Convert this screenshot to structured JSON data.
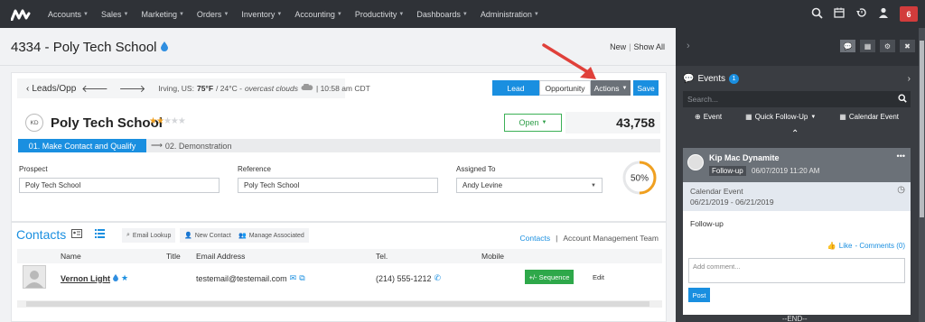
{
  "nav": {
    "menu": [
      "Accounts",
      "Sales",
      "Marketing",
      "Orders",
      "Inventory",
      "Accounting",
      "Productivity",
      "Dashboards",
      "Administration"
    ],
    "notification_count": "6"
  },
  "header": {
    "title": "4334 - Poly Tech School",
    "link_new": "New",
    "link_show_all": "Show All"
  },
  "toolbar": {
    "back_label": "Leads/Opp",
    "location": "Irving, US:",
    "temp_f": "75°F",
    "temp_c": "/ 24°C -",
    "conditions": "overcast clouds",
    "time": "| 10:58 am CDT",
    "lead_btn": "Lead",
    "opportunity_btn": "Opportunity",
    "actions_btn": "Actions",
    "save_btn": "Save"
  },
  "lead": {
    "initials": "KD",
    "name": "Poly Tech School",
    "rating": 2,
    "rating_max": 5,
    "status": "Open",
    "amount": "43,758"
  },
  "stages": {
    "current": "01. Make Contact and Qualify",
    "next": "02. Demonstration"
  },
  "fields": {
    "prospect_label": "Prospect",
    "prospect_value": "Poly Tech School",
    "reference_label": "Reference",
    "reference_value": "Poly Tech School",
    "assigned_label": "Assigned To",
    "assigned_value": "Andy Levine",
    "progress_text": "50%",
    "progress_fraction": 0.5
  },
  "contacts": {
    "title": "Contacts",
    "email_lookup": "Email Lookup",
    "new_contact": "New Contact",
    "manage_associated": "Manage Associated",
    "tab_contacts": "Contacts",
    "tab_sep": "|",
    "tab_account_team": "Account Management Team",
    "columns": [
      "Name",
      "Title",
      "Email Address",
      "Tel.",
      "Mobile"
    ],
    "rows": [
      {
        "name": "Vernon Light",
        "title": "",
        "email": "testemail@testemail.com",
        "tel": "(214) 555-1212",
        "mobile": "",
        "sequence_btn": "+/- Sequence",
        "edit": "Edit"
      }
    ]
  },
  "side": {
    "events_title": "Events",
    "events_count": "1",
    "search_placeholder": "Search...",
    "action_event": "Event",
    "action_quick_follow": "Quick Follow-Up",
    "action_calendar": "Calendar Event",
    "card": {
      "name": "Kip Mac Dynamite",
      "tag": "Follow-up",
      "date": "06/07/2019 11:20 AM",
      "type": "Calendar Event",
      "range": "06/21/2019 - 06/21/2019",
      "body": "Follow-up",
      "like": "Like",
      "comments": "- Comments (0)",
      "comment_placeholder": "Add comment...",
      "post_btn": "Post"
    },
    "end_text": "--END--"
  },
  "colors": {
    "accent": "#1a8fe0",
    "nav_bg": "#2f3237",
    "success": "#2ea84a",
    "badge": "#d23c3c",
    "star": "#f0a020",
    "annotation": "#e0403a"
  }
}
